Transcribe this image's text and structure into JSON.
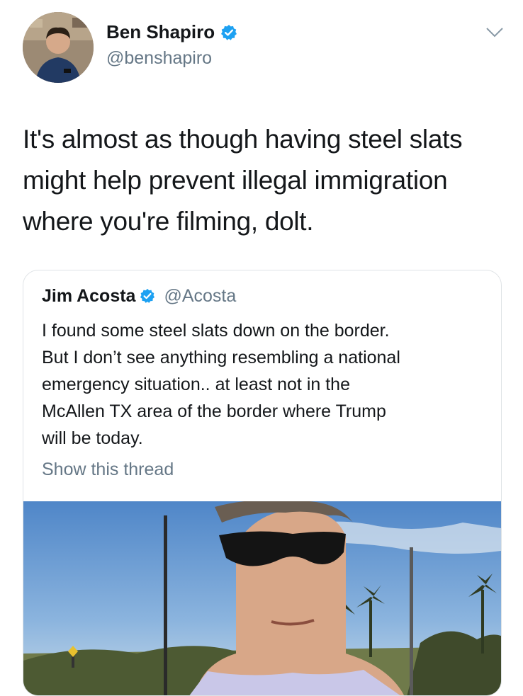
{
  "author": {
    "name": "Ben Shapiro",
    "handle": "@benshapiro",
    "avatar_icon": "profile-photo",
    "verified_icon": "verified-badge-icon"
  },
  "tweet": {
    "lines": [
      "It's almost as though having steel slats",
      "might help prevent illegal immigration",
      "where you're filming, dolt."
    ]
  },
  "quoted": {
    "name": "Jim Acosta",
    "handle": "@Acosta",
    "lines": [
      "I found some steel slats down on the border.",
      "But I don’t see anything resembling a national",
      "emergency situation.. at least not in the",
      "McAllen TX area of the border where Trump",
      "will be today."
    ],
    "show_thread": "Show this thread"
  },
  "colors": {
    "verified": "#1da1f2",
    "secondary_text": "#657786",
    "border": "#dfe3e6"
  }
}
